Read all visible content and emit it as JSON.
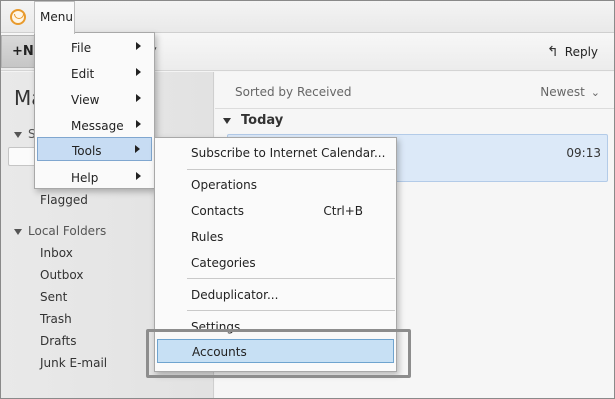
{
  "titlebar": {
    "menu_label": "Menu"
  },
  "toolbar": {
    "new_label": "N",
    "reply_label": "Reply"
  },
  "leftpane": {
    "account_title": "Ma",
    "section_s": "S",
    "folders_top": [
      "Flagged"
    ],
    "local_folders_label": "Local Folders",
    "local_folders": [
      "Inbox",
      "Outbox",
      "Sent",
      "Trash",
      "Drafts",
      "Junk E-mail"
    ]
  },
  "msgpane": {
    "sorted_by": "Sorted by Received",
    "order": "Newest",
    "group_label": "Today",
    "message_time": "09:13"
  },
  "main_menu": {
    "items": [
      {
        "label": "File"
      },
      {
        "label": "Edit"
      },
      {
        "label": "View"
      },
      {
        "label": "Message"
      },
      {
        "label": "Tools"
      },
      {
        "label": "Help"
      }
    ]
  },
  "tools_menu": {
    "items": [
      {
        "label": "Subscribe to Internet Calendar..."
      },
      {
        "label": "Operations"
      },
      {
        "label": "Contacts",
        "shortcut": "Ctrl+B"
      },
      {
        "label": "Rules"
      },
      {
        "label": "Categories"
      },
      {
        "label": "Deduplicator..."
      },
      {
        "label": "Settings"
      },
      {
        "label": "Accounts"
      }
    ]
  },
  "colors": {
    "accent_highlight": "#c7e0f4",
    "selected_row": "#dce9f8",
    "app_icon": "#e89a2c"
  },
  "icons": [
    "app-logo-icon",
    "plus-icon",
    "chevron-down-icon",
    "reply-arrow-icon",
    "submenu-arrow-icon",
    "collapse-triangle-icon"
  ]
}
